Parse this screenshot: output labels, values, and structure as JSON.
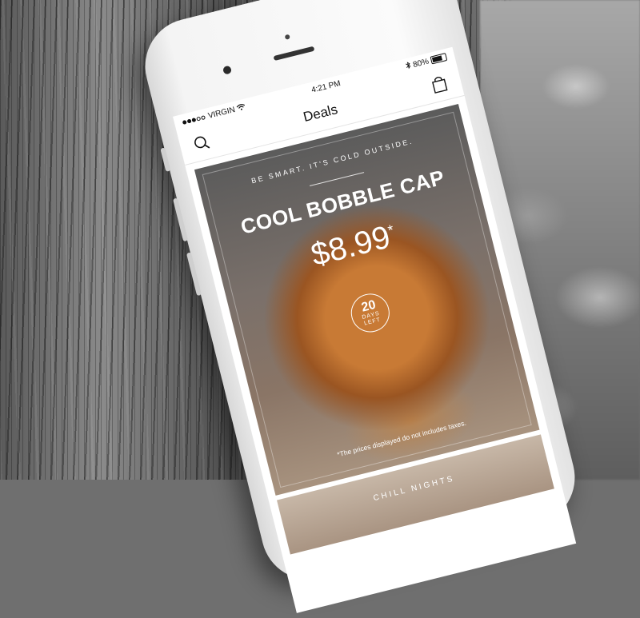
{
  "status_bar": {
    "carrier": "VIRGIN",
    "time": "4:21 PM",
    "battery": "80%"
  },
  "nav": {
    "title": "Deals",
    "search_icon": "search-icon",
    "bag_icon": "shopping-bag-icon"
  },
  "hero": {
    "tagline": "BE SMART. IT'S COLD OUTSIDE.",
    "headline": "COOL BOBBLE CAP",
    "price": "$8.99",
    "price_mark": "*",
    "days_number": "20",
    "days_label_1": "DAYS",
    "days_label_2": "LEFT",
    "disclaimer": "*The prices displayed do not includes taxes."
  },
  "next_card": {
    "label": "CHILL NIGHTS"
  }
}
